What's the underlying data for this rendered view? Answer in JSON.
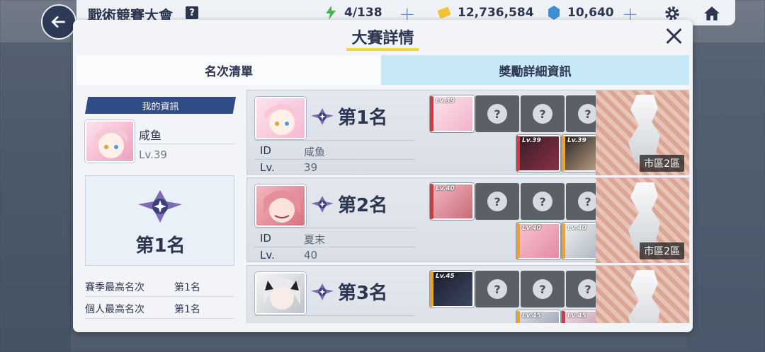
{
  "topbar": {
    "title": "戰術競賽大會",
    "help_label": "?",
    "stamina": "4/138",
    "coins": "12,736,584",
    "crystals": "10,640",
    "plus": "+"
  },
  "modal": {
    "title": "大賽詳情",
    "tabs": [
      "名次清單",
      "獎勵詳細資訊"
    ]
  },
  "my_info": {
    "header": "我的資訊",
    "name": "咸鱼",
    "level": "Lv.39",
    "rank": "第1名",
    "stats": [
      {
        "label": "賽季最高名次",
        "value": "第1名"
      },
      {
        "label": "個人最高名次",
        "value": "第1名"
      }
    ]
  },
  "labels": {
    "id": "ID",
    "lv": "Lv.",
    "unknown": "?"
  },
  "ranking": [
    {
      "rank": "第1名",
      "id": "咸鱼",
      "lv": "39",
      "map": "市區2區",
      "leader_lv": "Lv.39",
      "support_lv": [
        "Lv.39",
        "Lv.39"
      ]
    },
    {
      "rank": "第2名",
      "id": "夏末",
      "lv": "40",
      "map": "市區2區",
      "leader_lv": "Lv.40",
      "support_lv": [
        "Lv.40",
        "Lv.40"
      ]
    },
    {
      "rank": "第3名",
      "id": "",
      "lv": "",
      "map": "",
      "leader_lv": "Lv.45",
      "support_lv": [
        "Lv.45",
        "Lv.45"
      ]
    }
  ]
}
